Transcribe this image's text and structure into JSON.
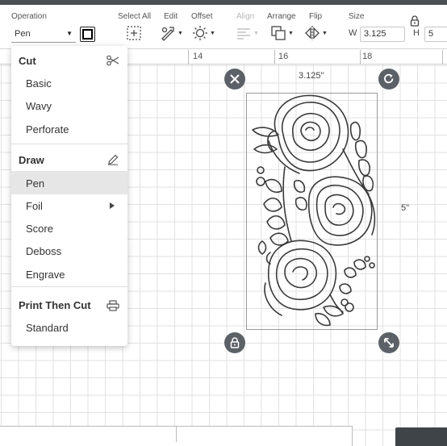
{
  "toolbar": {
    "operation_label": "Operation",
    "operation_value": "Pen",
    "select_all_label": "Select All",
    "edit_label": "Edit",
    "offset_label": "Offset",
    "align_label": "Align",
    "arrange_label": "Arrange",
    "flip_label": "Flip",
    "size_label": "Size",
    "width_letter": "W",
    "width_value": "3.125",
    "height_letter": "H",
    "height_value": "5"
  },
  "ruler": {
    "marks": [
      "14",
      "16",
      "18"
    ]
  },
  "object": {
    "width_label": "3.125\"",
    "height_label": "5\""
  },
  "operation_menu": {
    "cut_heading": "Cut",
    "cut_items": [
      "Basic",
      "Wavy",
      "Perforate"
    ],
    "draw_heading": "Draw",
    "draw_items": [
      "Pen",
      "Foil",
      "Score",
      "Deboss",
      "Engrave"
    ],
    "selected_item": "Pen",
    "print_heading": "Print Then Cut",
    "print_items": [
      "Standard"
    ]
  },
  "icons": {
    "cut": "scissors-icon",
    "draw": "pencil-icon",
    "print": "printer-icon",
    "foil_submenu": "chevron-right-icon"
  }
}
